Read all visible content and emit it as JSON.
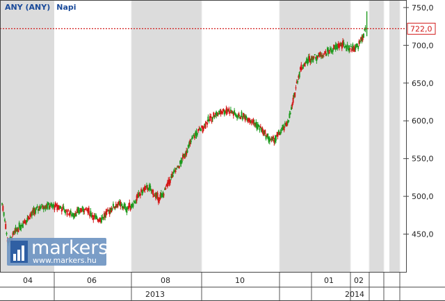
{
  "header": {
    "title": "ANY (ANY)",
    "period": "Napi"
  },
  "watermark": {
    "brand": "markers",
    "url": "www.markers.hu"
  },
  "colors": {
    "up": "#1f9a1f",
    "down": "#d41616",
    "shade": "#dcdcdc",
    "axis": "#333333",
    "last_line": "#d21a1a",
    "title": "#1a4a9a"
  },
  "chart_data": {
    "type": "candlestick",
    "title": "ANY (ANY)",
    "subtitle": "Napi",
    "xlabel": "",
    "ylabel": "",
    "ylim": [
      400,
      760
    ],
    "y_ticks": [
      "450,0",
      "500,0",
      "550,0",
      "600,0",
      "650,0",
      "700,0",
      "750,0"
    ],
    "y_tick_values": [
      450,
      500,
      550,
      600,
      650,
      700,
      750
    ],
    "x_month_labels": [
      "04",
      "06",
      "08",
      "10",
      "01",
      "02"
    ],
    "x_year_labels": [
      "2013",
      "2014"
    ],
    "last_value": 722,
    "last_value_label": "722,0",
    "grid": false,
    "series": [
      {
        "values": [
          [
            0,
            490
          ],
          [
            2,
            478
          ],
          [
            4,
            462
          ],
          [
            6,
            440
          ],
          [
            10,
            443
          ],
          [
            14,
            452
          ],
          [
            18,
            458
          ],
          [
            22,
            463
          ],
          [
            26,
            468
          ],
          [
            30,
            473
          ],
          [
            34,
            478
          ],
          [
            38,
            482
          ],
          [
            42,
            486
          ],
          [
            46,
            487
          ],
          [
            50,
            488
          ],
          [
            54,
            487
          ],
          [
            58,
            486
          ],
          [
            62,
            486
          ],
          [
            66,
            484
          ],
          [
            70,
            481
          ],
          [
            74,
            478
          ],
          [
            78,
            476
          ],
          [
            82,
            478
          ],
          [
            86,
            481
          ],
          [
            90,
            483
          ],
          [
            94,
            481
          ],
          [
            98,
            477
          ],
          [
            102,
            472
          ],
          [
            106,
            469
          ],
          [
            110,
            471
          ],
          [
            114,
            475
          ],
          [
            118,
            480
          ],
          [
            122,
            485
          ],
          [
            126,
            488
          ],
          [
            130,
            489
          ],
          [
            134,
            486
          ],
          [
            138,
            484
          ],
          [
            142,
            487
          ],
          [
            146,
            492
          ],
          [
            150,
            498
          ],
          [
            154,
            505
          ],
          [
            158,
            510
          ],
          [
            162,
            512
          ],
          [
            166,
            506
          ],
          [
            170,
            500
          ],
          [
            174,
            497
          ],
          [
            178,
            502
          ],
          [
            182,
            512
          ],
          [
            186,
            522
          ],
          [
            190,
            530
          ],
          [
            194,
            537
          ],
          [
            198,
            545
          ],
          [
            202,
            555
          ],
          [
            206,
            565
          ],
          [
            210,
            575
          ],
          [
            214,
            582
          ],
          [
            218,
            587
          ],
          [
            222,
            591
          ],
          [
            226,
            597
          ],
          [
            230,
            602
          ],
          [
            234,
            607
          ],
          [
            238,
            609
          ],
          [
            242,
            612
          ],
          [
            246,
            613
          ],
          [
            250,
            614
          ],
          [
            254,
            612
          ],
          [
            258,
            608
          ],
          [
            262,
            606
          ],
          [
            266,
            606
          ],
          [
            270,
            605
          ],
          [
            274,
            602
          ],
          [
            278,
            598
          ],
          [
            282,
            594
          ],
          [
            286,
            590
          ],
          [
            290,
            584
          ],
          [
            294,
            578
          ],
          [
            298,
            574
          ],
          [
            302,
            576
          ],
          [
            306,
            582
          ],
          [
            310,
            588
          ],
          [
            314,
            594
          ],
          [
            318,
            605
          ],
          [
            322,
            625
          ],
          [
            326,
            650
          ],
          [
            330,
            668
          ],
          [
            334,
            675
          ],
          [
            338,
            680
          ],
          [
            342,
            683
          ],
          [
            346,
            685
          ],
          [
            350,
            686
          ],
          [
            354,
            688
          ],
          [
            358,
            690
          ],
          [
            362,
            693
          ],
          [
            366,
            695
          ],
          [
            370,
            698
          ],
          [
            374,
            700
          ],
          [
            378,
            700
          ],
          [
            382,
            698
          ],
          [
            386,
            696
          ],
          [
            390,
            697
          ],
          [
            394,
            700
          ],
          [
            398,
            708
          ],
          [
            402,
            722
          ]
        ]
      }
    ]
  },
  "x_axis": {
    "month_ticks": [
      {
        "label": "04",
        "c": 40
      },
      {
        "label": "06",
        "c": 132
      },
      {
        "label": "08",
        "c": 238
      },
      {
        "label": "10",
        "c": 345
      },
      {
        "label": "01",
        "c": 473
      },
      {
        "label": "02",
        "c": 516
      }
    ],
    "year_ticks": [
      {
        "label": "2013",
        "c": 223
      },
      {
        "label": "2014",
        "c": 510
      }
    ]
  }
}
